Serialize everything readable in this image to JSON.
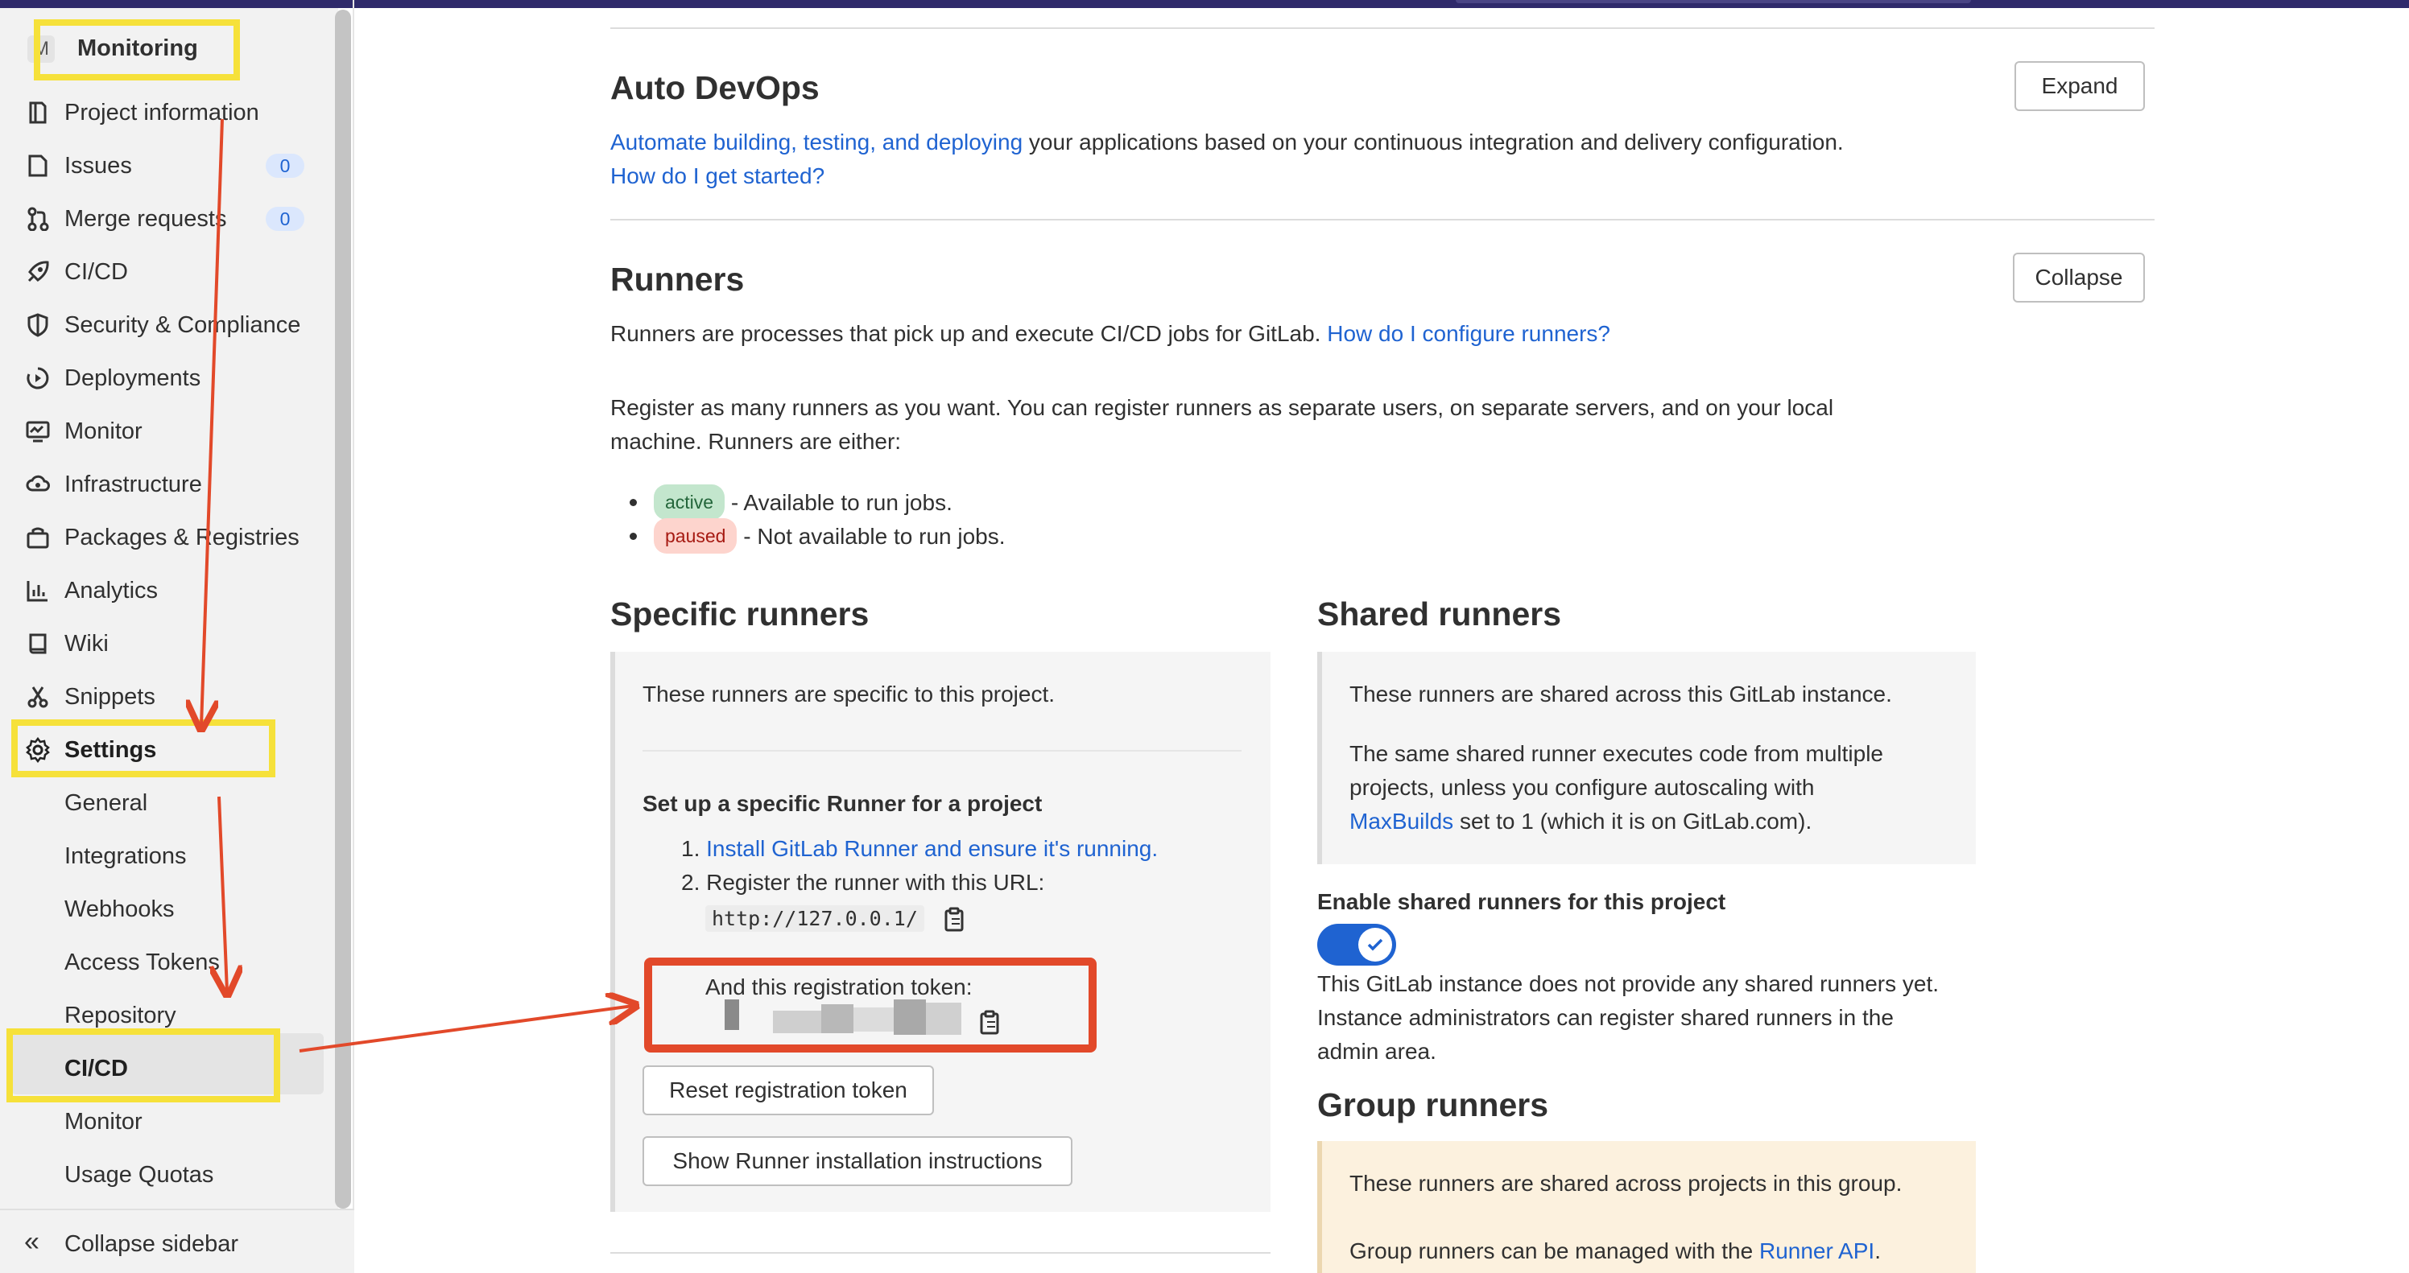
{
  "sidebar": {
    "context_letter": "M",
    "context_title": "Monitoring",
    "items": [
      {
        "label": "Project information",
        "icon": "project-icon"
      },
      {
        "label": "Issues",
        "icon": "issues-icon",
        "badge": "0"
      },
      {
        "label": "Merge requests",
        "icon": "merge-request-icon",
        "badge": "0"
      },
      {
        "label": "CI/CD",
        "icon": "rocket-icon"
      },
      {
        "label": "Security & Compliance",
        "icon": "shield-icon"
      },
      {
        "label": "Deployments",
        "icon": "deployments-icon"
      },
      {
        "label": "Monitor",
        "icon": "monitor-icon"
      },
      {
        "label": "Infrastructure",
        "icon": "cloud-gear-icon"
      },
      {
        "label": "Packages & Registries",
        "icon": "package-icon"
      },
      {
        "label": "Analytics",
        "icon": "chart-icon"
      },
      {
        "label": "Wiki",
        "icon": "book-icon"
      },
      {
        "label": "Snippets",
        "icon": "scissors-icon"
      },
      {
        "label": "Settings",
        "icon": "gear-icon"
      }
    ],
    "settings_sub": [
      "General",
      "Integrations",
      "Webhooks",
      "Access Tokens",
      "Repository",
      "CI/CD",
      "Monitor",
      "Usage Quotas"
    ],
    "collapse_label": "Collapse sidebar"
  },
  "auto_devops": {
    "title": "Auto DevOps",
    "button": "Expand",
    "link1": "Automate building, testing, and deploying",
    "text1": " your applications based on your continuous integration and delivery configuration.",
    "link2": "How do I get started?"
  },
  "runners": {
    "title": "Runners",
    "button": "Collapse",
    "intro": "Runners are processes that pick up and execute CI/CD jobs for GitLab. ",
    "intro_link": "How do I configure runners?",
    "register_line1": "Register as many runners as you want. You can register runners as separate users, on separate servers, and on your local",
    "register_line2": "machine. Runners are either:",
    "active_pill": "active",
    "active_text": " - Available to run jobs.",
    "paused_pill": "paused",
    "paused_text": " - Not available to run jobs."
  },
  "specific": {
    "title": "Specific runners",
    "desc": "These runners are specific to this project.",
    "setup_title": "Set up a specific Runner for a project",
    "step1_num": "1.",
    "step1_link": "Install GitLab Runner and ensure it's running.",
    "step2_num": "2.",
    "step2_text": "Register the runner with this URL:",
    "url": "http://127.0.0.1/",
    "token_label": "And this registration token:",
    "reset_button": "Reset registration token",
    "show_button": "Show Runner installation instructions"
  },
  "shared": {
    "title": "Shared runners",
    "desc1": "These runners are shared across this GitLab instance.",
    "desc2_line1": "The same shared runner executes code from multiple",
    "desc2_line2": "projects, unless you configure autoscaling with",
    "desc2_link": "MaxBuilds",
    "desc2_line3": " set to 1 (which it is on GitLab.com).",
    "enable_label": "Enable shared runners for this project",
    "toggle_on": true,
    "note_line1": "This GitLab instance does not provide any shared runners yet.",
    "note_line2": "Instance administrators can register shared runners in the",
    "note_line3": "admin area."
  },
  "group": {
    "title": "Group runners",
    "desc1": "These runners are shared across projects in this group.",
    "desc2": "Group runners can be managed with the ",
    "desc2_link": "Runner API",
    "desc2_end": "."
  },
  "colors": {
    "link": "#1f63d1",
    "annotation_yellow": "#f6e13a",
    "annotation_red": "#e2492a",
    "toggle": "#1f63d1"
  }
}
